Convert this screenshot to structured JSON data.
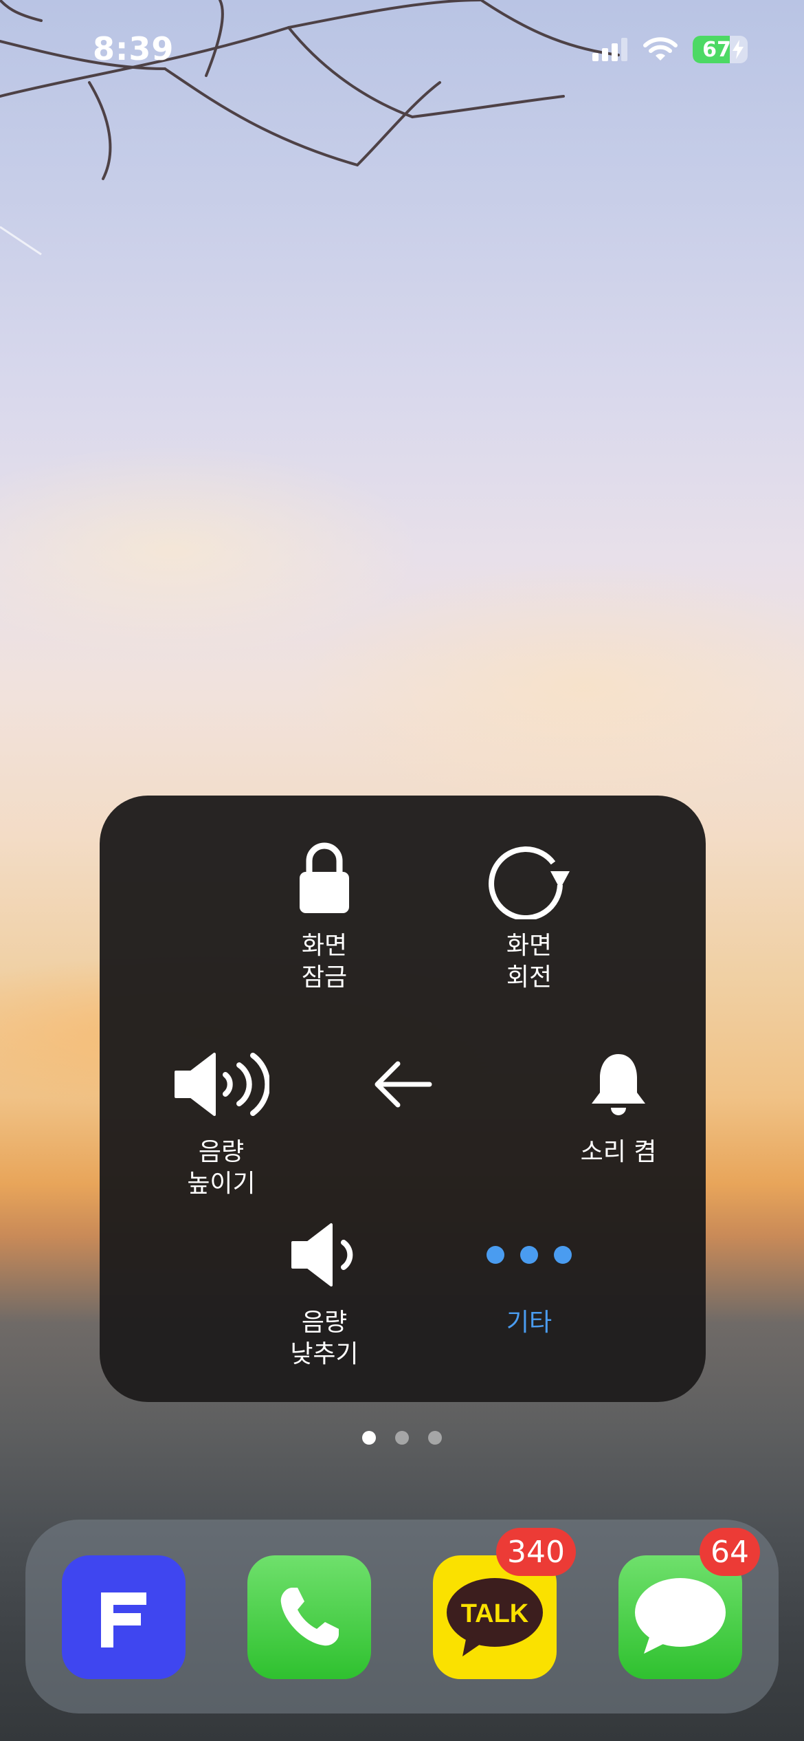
{
  "status_bar": {
    "time": "8:39",
    "battery_percent": "67",
    "battery_level": 0.67,
    "signal_icon": "cellular-signal-icon",
    "wifi_icon": "wifi-icon",
    "charging_icon": "charging-bolt-icon"
  },
  "assistive_touch": {
    "lock_screen": {
      "label": "화면\n잠금",
      "icon": "lock-icon"
    },
    "rotate_screen": {
      "label": "화면\n회전",
      "icon": "rotate-icon"
    },
    "volume_up": {
      "label": "음량\n높이기",
      "icon": "volume-up-icon"
    },
    "back": {
      "icon": "back-arrow-icon"
    },
    "unmute": {
      "label": "소리 켬",
      "icon": "bell-icon"
    },
    "volume_down": {
      "label": "음량\n낮추기",
      "icon": "volume-down-icon"
    },
    "more": {
      "label": "기타",
      "icon": "more-icon"
    },
    "accent_color": "#4a9cf0"
  },
  "page_indicator": {
    "count": 3,
    "active": 0
  },
  "dock": {
    "apps": [
      {
        "name": "flow-app",
        "icon": "flow-app-icon",
        "badge": ""
      },
      {
        "name": "phone",
        "icon": "phone-icon",
        "badge": ""
      },
      {
        "name": "kakaotalk",
        "icon": "kakaotalk-icon",
        "logo_text": "TALK",
        "badge": "340"
      },
      {
        "name": "messages",
        "icon": "messages-icon",
        "badge": "64"
      }
    ]
  }
}
